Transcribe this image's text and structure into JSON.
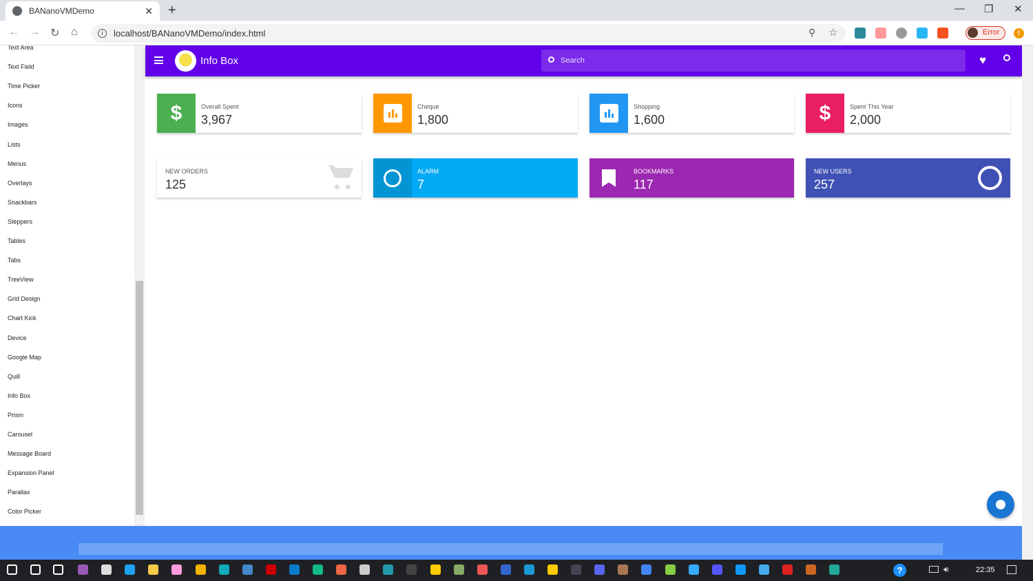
{
  "browser": {
    "tab_title": "BANanoVMDemo",
    "url": "localhost/BANanoVMDemo/index.html",
    "profile_status": "Error"
  },
  "sidebar": {
    "items": [
      "Text Area",
      "Text Field",
      "Time Picker",
      "Icons",
      "Images",
      "Lists",
      "Menus",
      "Overlays",
      "Snackbars",
      "Steppers",
      "Tables",
      "Tabs",
      "TreeView",
      "Grid Design",
      "Chart Kick",
      "Device",
      "Google Map",
      "Quill",
      "Info Box",
      "Prism",
      "Carousel",
      "Message Board",
      "Expansion Panel",
      "Parallax",
      "Color Picker"
    ]
  },
  "appbar": {
    "title": "Info Box",
    "search_placeholder": "Search"
  },
  "cards_row1": [
    {
      "label": "Overall Spent",
      "value": "3,967",
      "color": "#4caf50",
      "icon": "dollar-icon"
    },
    {
      "label": "Cheque",
      "value": "1,800",
      "color": "#ff9800",
      "icon": "bar-chart-icon"
    },
    {
      "label": "Shopping",
      "value": "1,600",
      "color": "#2196f3",
      "icon": "bar-chart-icon"
    },
    {
      "label": "Spent This Year",
      "value": "2,000",
      "color": "#e91e63",
      "icon": "dollar-icon"
    }
  ],
  "cards_row2": [
    {
      "label": "NEW ORDERS",
      "value": "125",
      "icon": "cart-icon"
    },
    {
      "label": "ALARM",
      "value": "7",
      "color": "#03a9f4",
      "icon": "alarm-icon"
    },
    {
      "label": "BOOKMARKS",
      "value": "117",
      "color": "#9c27b0",
      "icon": "bookmark-icon"
    },
    {
      "label": "NEW USERS",
      "value": "257",
      "color": "#3f51b5",
      "icon": "face-icon"
    }
  ],
  "taskbar": {
    "time": "22:35",
    "icon_colors": [
      "#9b59b6",
      "#ddd",
      "#1da1f2",
      "#f7c948",
      "#f9d",
      "#f5b400",
      "#1ab",
      "#48c",
      "#c00",
      "#0a7acc",
      "#1b8",
      "#e64",
      "#ccc",
      "#29a",
      "#444",
      "#fc0",
      "#8a6",
      "#e55",
      "#36c",
      "#1a9ad6",
      "#fc0",
      "#445",
      "#5865f2",
      "#a75",
      "#4285f4",
      "#8c4",
      "#3af",
      "#55f",
      "#19f",
      "#4ae",
      "#d22",
      "#c62",
      "#2a9"
    ]
  }
}
